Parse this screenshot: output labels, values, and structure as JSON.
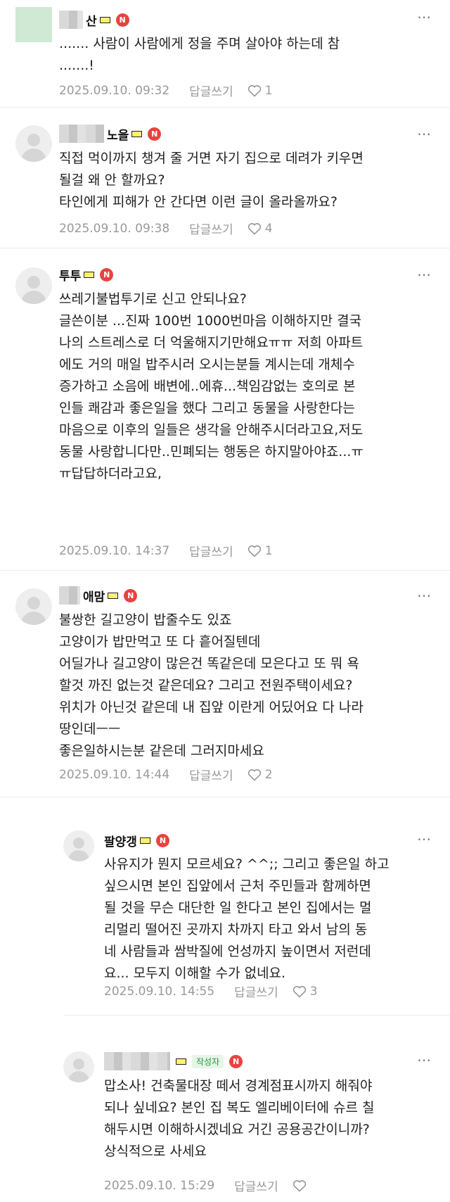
{
  "comments": [
    {
      "name": "산",
      "badge": "N",
      "text": "....... 사람이 사람에게 정을 주며 살아야 하는데 참\n.......!",
      "date": "2025.09.10. 09:32",
      "reply_label": "답글쓰기",
      "likes": "1"
    },
    {
      "name": "노을",
      "badge": "N",
      "text": "직접 먹이까지 챙겨 줄 거면 자기 집으로 데려가 키우면\n될걸 왜 안 할까요?\n타인에게 피해가 안 간다면 이런 글이 올라올까요?",
      "date": "2025.09.10. 09:38",
      "reply_label": "답글쓰기",
      "likes": "4"
    },
    {
      "name": "투투",
      "badge": "N",
      "text": "쓰레기불법투기로 신고 안되나요?\n글쓴이분 ...진짜 100번 1000번마음 이해하지만 결국\n나의 스트레스로 더 억울해지기만해요ㅠㅠ 저희 아파트\n에도 거의 매일 밥주시러 오시는분들 계시는데 개체수\n증가하고 소음에 배변에..에휴...책임감없는 호의로 본\n인들 쾌감과 좋은일을 했다 그리고 동물을 사랑한다는\n마음으로 이후의 일들은 생각을 안해주시더라고요,저도\n동물 사랑합니다만..민폐되는 행동은 하지말아야죠...ㅠ\nㅠ답답하더라고요,",
      "date": "2025.09.10. 14:37",
      "reply_label": "답글쓰기",
      "likes": "1"
    },
    {
      "name": "애맘",
      "badge": "N",
      "text": "불쌍한 길고양이 밥줄수도 있죠\n고양이가 밥만먹고 또 다 흩어질텐데\n어딜가나 길고양이 많은건 똑같은데 모은다고 또 뭐 욕\n할것 까진 없는것 같은데요? 그리고 전원주택이세요?\n위치가 아닌것 같은데 내 집앞 이란게 어딨어요 다 나라\n땅인데ㅡㅡ\n좋은일하시는분 같은데 그러지마세요",
      "date": "2025.09.10. 14:44",
      "reply_label": "답글쓰기",
      "likes": "2"
    },
    {
      "name": "팔양갱",
      "badge": "N",
      "text": "사유지가 뭔지 모르세요? ^^;; 그리고 좋은일 하고\n싶으시면 본인 집앞에서 근처 주민들과 함께하면\n될 것을 무슨 대단한 일 한다고 본인 집에서는 멀\n리멀리 떨어진 곳까지 차까지 타고 와서 남의 동\n네 사람들과 쌈박질에 언성까지 높이면서 저런데\n요... 모두지 이해할 수가 없네요.",
      "date": "2025.09.10. 14:55",
      "reply_label": "답글쓰기",
      "likes": "3"
    },
    {
      "name": "",
      "author_tag": "작성자",
      "badge": "N",
      "text": "맙소사! 건축물대장 떼서 경계점표시까지 해줘야\n되나 싶네요? 본인 집 복도 엘리베이터에 슈르 칠\n해두시면 이해하시겠네요 거긴 공용공간이니까?\n상식적으로 사세요",
      "date": "2025.09.10. 15:29",
      "reply_label": "답글쓰기",
      "likes": ""
    }
  ],
  "more_icon": "⋯",
  "icons": {
    "more": "more-dots-icon",
    "heart": "heart-icon",
    "avatar": "default-avatar-icon"
  },
  "colors": {
    "badge": "#e8433f",
    "author_tag": "#1b9c3e",
    "meta": "#999999"
  }
}
